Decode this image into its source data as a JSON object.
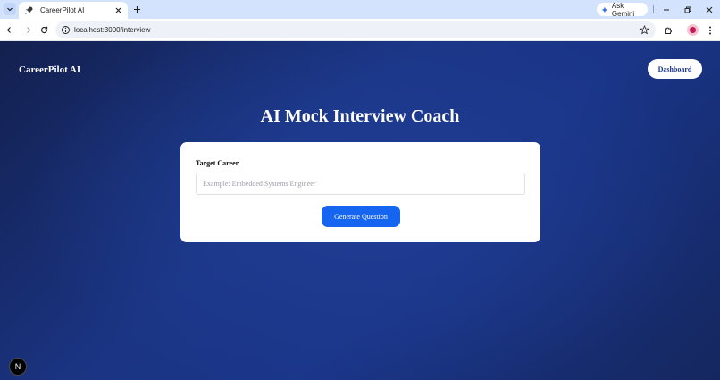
{
  "browser": {
    "tab_title": "CareerPilot AI",
    "ask_gemini_label": "Ask Gemini",
    "url": "localhost:3000/interview",
    "icons": {
      "tab_search": "chevron-down-icon",
      "favicon": "rocket-icon",
      "close": "close-icon",
      "new_tab": "plus-icon",
      "gemini": "sparkle-icon",
      "minimize": "minimize-icon",
      "restore": "restore-icon",
      "window_close": "close-icon",
      "back": "back-arrow-icon",
      "forward": "forward-arrow-icon",
      "reload": "reload-icon",
      "site_info": "info-icon",
      "bookmark": "star-icon",
      "extensions": "puzzle-icon",
      "menu": "kebab-menu-icon"
    }
  },
  "app": {
    "brand": "CareerPilot AI",
    "dashboard_label": "Dashboard",
    "page_title": "AI Mock Interview Coach",
    "form": {
      "label": "Target Career",
      "placeholder": "Example: Embedded Systems Engineer",
      "value": "",
      "submit_label": "Generate Question"
    },
    "dev_badge": "N"
  },
  "colors": {
    "accent": "#1565f0",
    "background_dark": "#13204f",
    "background_mid": "#1b3584",
    "card": "#ffffff"
  }
}
